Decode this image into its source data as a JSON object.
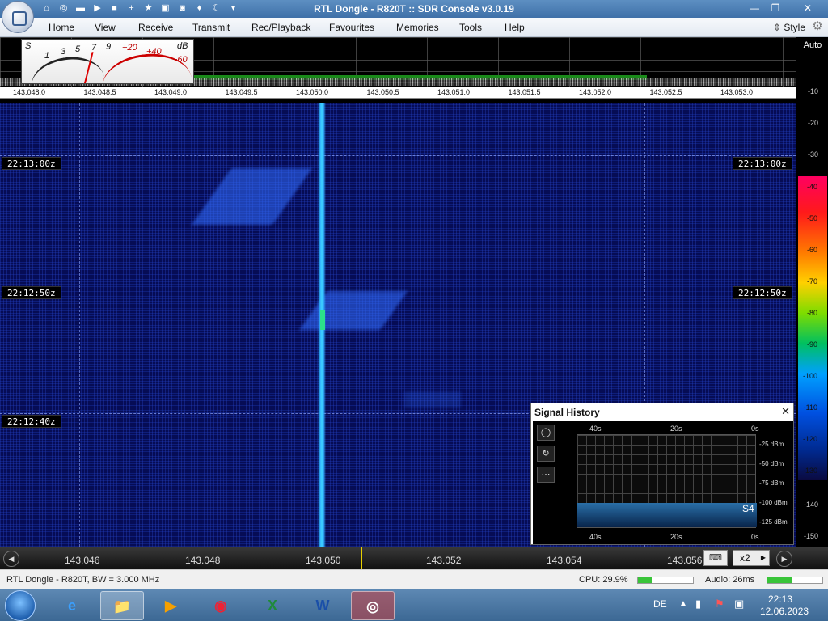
{
  "window": {
    "title": "RTL Dongle - R820T :: SDR Console v3.0.19",
    "min": "—",
    "max": "❐",
    "close": "✕"
  },
  "quick_access": [
    "home-icon",
    "help-icon",
    "folder-icon",
    "play-icon",
    "stop-icon",
    "add-icon",
    "star-icon",
    "lock-icon",
    "camera-icon",
    "drop-icon",
    "moon-icon",
    "dropdown-icon"
  ],
  "menu": {
    "items": [
      "Home",
      "View",
      "Receive",
      "Transmit",
      "Rec/Playback",
      "Favourites",
      "Memories",
      "Tools",
      "Help"
    ],
    "style": "Style"
  },
  "smeter": {
    "scale_black": [
      "S",
      "1",
      "3",
      "5",
      "7",
      "9"
    ],
    "scale_red": [
      "+20",
      "+40",
      "+60"
    ],
    "unit": "dB"
  },
  "spectrum": {
    "freq_ticks": [
      "143.048.0",
      "143.048.5",
      "143.049.0",
      "143.049.5",
      "143.050.0",
      "143.050.5",
      "143.051.0",
      "143.051.5",
      "143.052.0",
      "143.052.5",
      "143.053.0"
    ]
  },
  "db_panel": {
    "auto_label": "Auto",
    "ticks": [
      "-10",
      "-20",
      "-30"
    ],
    "scale_ticks": [
      "-40",
      "-50",
      "-60",
      "-70",
      "-80",
      "-90",
      "-100",
      "-110",
      "-120",
      "-130"
    ],
    "lower_ticks": [
      "-140",
      "-150"
    ]
  },
  "waterfall": {
    "timestamps": [
      "22:13:00z",
      "22:12:50z",
      "22:12:40z"
    ]
  },
  "signal_history": {
    "title": "Signal History",
    "close": "✕",
    "buttons": [
      "◯",
      "↻",
      "⋯"
    ],
    "time_top": [
      "40s",
      "20s",
      "0s"
    ],
    "time_bottom": [
      "40s",
      "20s",
      "0s"
    ],
    "db_labels": [
      "-25 dBm",
      "-50 dBm",
      "-75 dBm",
      "-100 dBm",
      "-125 dBm"
    ],
    "signal_label": "S4"
  },
  "bottom_bar": {
    "freq_ticks": [
      "143.046",
      "143.048",
      "143.050",
      "143.052",
      "143.054",
      "143.056"
    ],
    "keyboard": "⌨",
    "zoom": "x2"
  },
  "status": {
    "device": "RTL Dongle - R820T, BW = 3.000 MHz",
    "cpu": "CPU: 29.9%",
    "cpu_level": 0.25,
    "audio": "Audio: 26ms",
    "audio_level": 0.45
  },
  "taskbar": {
    "apps": [
      "e",
      "📁",
      "▶",
      "◉",
      "X",
      "W",
      "◎"
    ],
    "lang": "DE",
    "time": "22:13",
    "date": "12.06.2023"
  },
  "colors": {
    "accent": "#3f70a8",
    "waterfall_bg": "#060c55",
    "carrier": "#3fd0ff"
  }
}
